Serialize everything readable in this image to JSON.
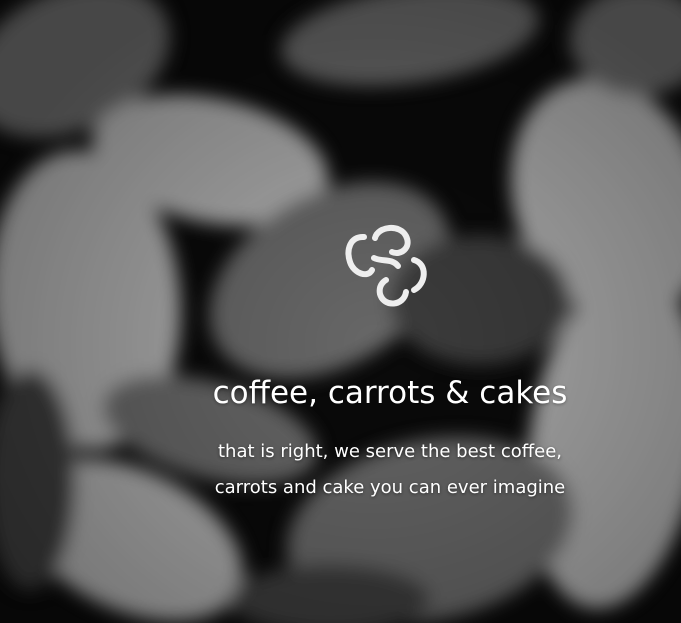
{
  "hero": {
    "title": "coffee, carrots & cakes",
    "subtitle": "that is right, we serve the best coffee, carrots and cake you can ever imagine"
  },
  "logo": {
    "icon": "trefoil-logo-icon",
    "color": "#eeeeee"
  },
  "colors": {
    "text": "#ffffff",
    "background": "#0b0b0b"
  }
}
